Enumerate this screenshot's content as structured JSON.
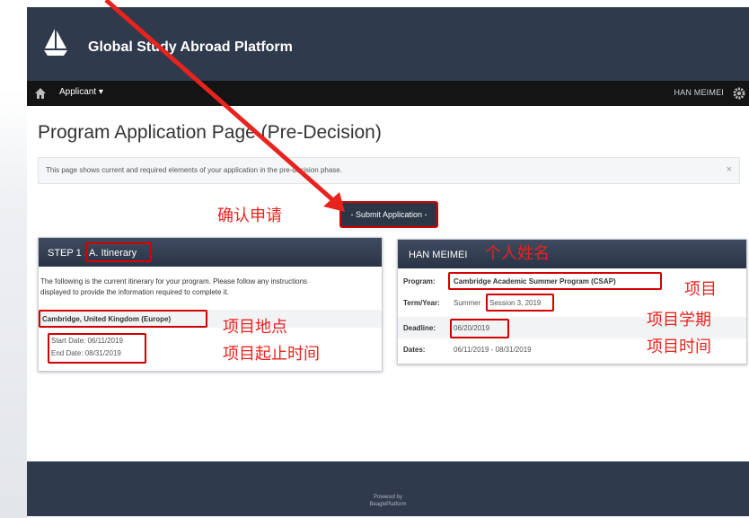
{
  "header": {
    "brand": "Global Study Abroad Platform"
  },
  "navbar": {
    "applicant_menu": "Applicant ▾",
    "user_name": "HAN MEIMEI"
  },
  "page": {
    "title": "Program Application Page (Pre-Decision)"
  },
  "info_alert": {
    "text": "This page shows current and required elements of your application in the pre-decision phase.",
    "close": "×"
  },
  "submit": {
    "label": "- Submit Application -"
  },
  "itinerary": {
    "step_prefix": "STEP 1",
    "step_title": "A. Itinerary",
    "description_line1": "The following is the current itinerary for your program. Please follow any instructions",
    "description_line2": "displayed to provide the information required to complete it.",
    "location": "Cambridge, United Kingdom (Europe)",
    "start_date": "Start Date: 06/11/2019",
    "end_date": "End Date: 08/31/2019"
  },
  "profile": {
    "name": "HAN MEIMEI",
    "program_label": "Program:",
    "program_value": "Cambridge Academic Summer Program (CSAP)",
    "term_label": "Term/Year:",
    "term_prefix": "Summer",
    "term_value": "Session 3, 2019",
    "deadline_label": "Deadline:",
    "deadline_value": "06/20/2019",
    "dates_label": "Dates:",
    "dates_value": "06/11/2019 - 08/31/2019"
  },
  "annotations": {
    "confirm": "确认申请",
    "personal_name": "个人姓名",
    "program": "项目",
    "term": "项目学期",
    "dates": "项目时间",
    "location": "项目地点",
    "start_end": "项目起止时间"
  },
  "footer": {
    "powered_by": "Powered by",
    "platform": "BeaglePlatform"
  },
  "colors": {
    "header": "#2f3a4c",
    "navbar": "#141414",
    "annotation_red": "#e8231e"
  }
}
